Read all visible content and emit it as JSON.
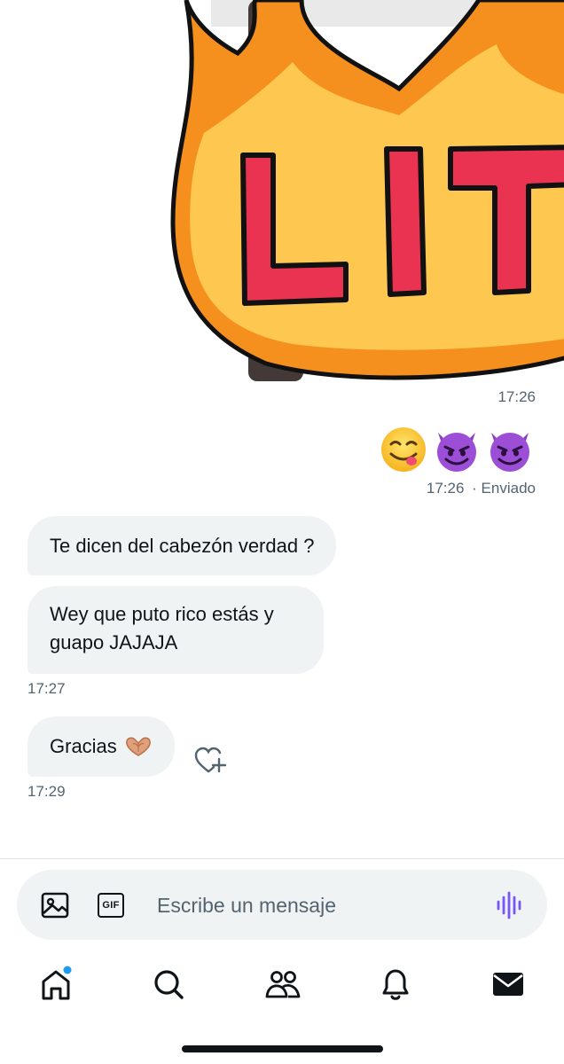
{
  "sticker": {
    "text": "LIT",
    "timestamp": "17:26",
    "colors": {
      "flame_outer": "#f5901e",
      "flame_inner": "#fdc750",
      "letters": "#ea3350",
      "outline": "#111111"
    }
  },
  "outgoing": {
    "emojis": [
      {
        "icon": "face-savoring-food-icon"
      },
      {
        "icon": "smiling-imp-icon"
      },
      {
        "icon": "smiling-imp-icon"
      }
    ],
    "timestamp": "17:26",
    "status": "· Enviado"
  },
  "incoming": [
    {
      "text": "Te dicen del cabezón verdad ?"
    },
    {
      "line1": "Wey que puto rico estás y",
      "line2": "guapo JAJAJA"
    }
  ],
  "incoming_timestamp": "17:27",
  "reply": {
    "text": "Gracias",
    "emoji_icon": "heart-hands-icon",
    "timestamp": "17:29",
    "react_icon": "add-reaction-heart-icon"
  },
  "composer": {
    "placeholder": "Escribe un mensaje",
    "media_icon": "image-icon",
    "gif_label": "GIF",
    "voice_icon": "voice-wave-icon",
    "accent": "#7856ff"
  },
  "nav": {
    "items": [
      {
        "icon": "home-icon",
        "badge": true
      },
      {
        "icon": "search-icon"
      },
      {
        "icon": "communities-icon"
      },
      {
        "icon": "bell-icon"
      },
      {
        "icon": "mail-icon",
        "active": true
      }
    ],
    "badge_color": "#1d9bf0"
  }
}
